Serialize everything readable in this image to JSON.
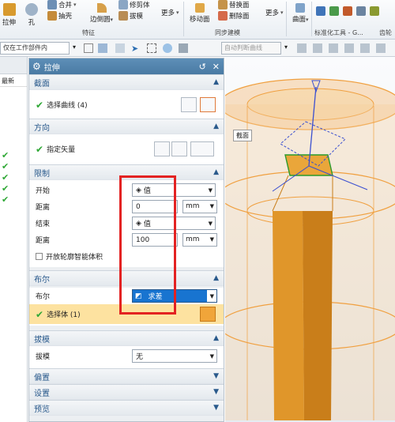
{
  "ribbon": {
    "items": [
      {
        "label": "拉伸"
      },
      {
        "label": "孔"
      },
      {
        "label": "合并"
      },
      {
        "label": "抽壳"
      },
      {
        "label": "边倒圆"
      },
      {
        "label": "修剪体"
      },
      {
        "label": "拔模"
      },
      {
        "label": "更多"
      },
      {
        "label": "移动面"
      },
      {
        "label": "替换面"
      },
      {
        "label": "删除面"
      },
      {
        "label": "更多"
      },
      {
        "label": "曲面"
      }
    ],
    "groups": {
      "feature": "特征",
      "sync": "同步建模",
      "stdtools": "标准化工具 - G...",
      "gear": "齿轮"
    }
  },
  "toolbar2": {
    "filter_combo": "仅在工作部件内",
    "curve_rule_combo": "自动判断曲线"
  },
  "navigator": {
    "header": "最新",
    "checks": [
      "✔",
      "✔",
      "✔",
      "✔",
      "✔"
    ]
  },
  "dialog": {
    "title": "拉伸",
    "sections": {
      "section_curve": {
        "title": "截面",
        "select_curve": "选择曲线 (4)"
      },
      "direction": {
        "title": "方向",
        "specify_vector": "指定矢量"
      },
      "limits": {
        "title": "限制",
        "start_label": "开始",
        "start_value": "值",
        "distance1_label": "距离",
        "distance1_value": "0",
        "distance1_unit": "mm",
        "end_label": "结束",
        "end_value": "值",
        "distance2_label": "距离",
        "distance2_value": "100",
        "distance2_unit": "mm",
        "open_profile": "开放轮廓智能体积"
      },
      "boolean": {
        "title": "布尔",
        "boolean_label": "布尔",
        "boolean_value": "求差",
        "select_body": "选择体 (1)"
      },
      "draft": {
        "title": "拔模",
        "draft_label": "拔模",
        "draft_value": "无"
      },
      "offset": {
        "title": "偏置"
      },
      "settings": {
        "title": "设置"
      },
      "preview": {
        "title": "预览"
      }
    }
  },
  "viewport": {
    "section_label": "截面"
  },
  "colors": {
    "dialog_title_bg": "#4a7aa3",
    "section_title": "#2a5a8c",
    "check_green": "#2fa836",
    "highlight_row": "#fde2a0",
    "boolean_selected": "#1874d0",
    "red_box": "#e32222",
    "body_orange": "#e8a53a"
  }
}
